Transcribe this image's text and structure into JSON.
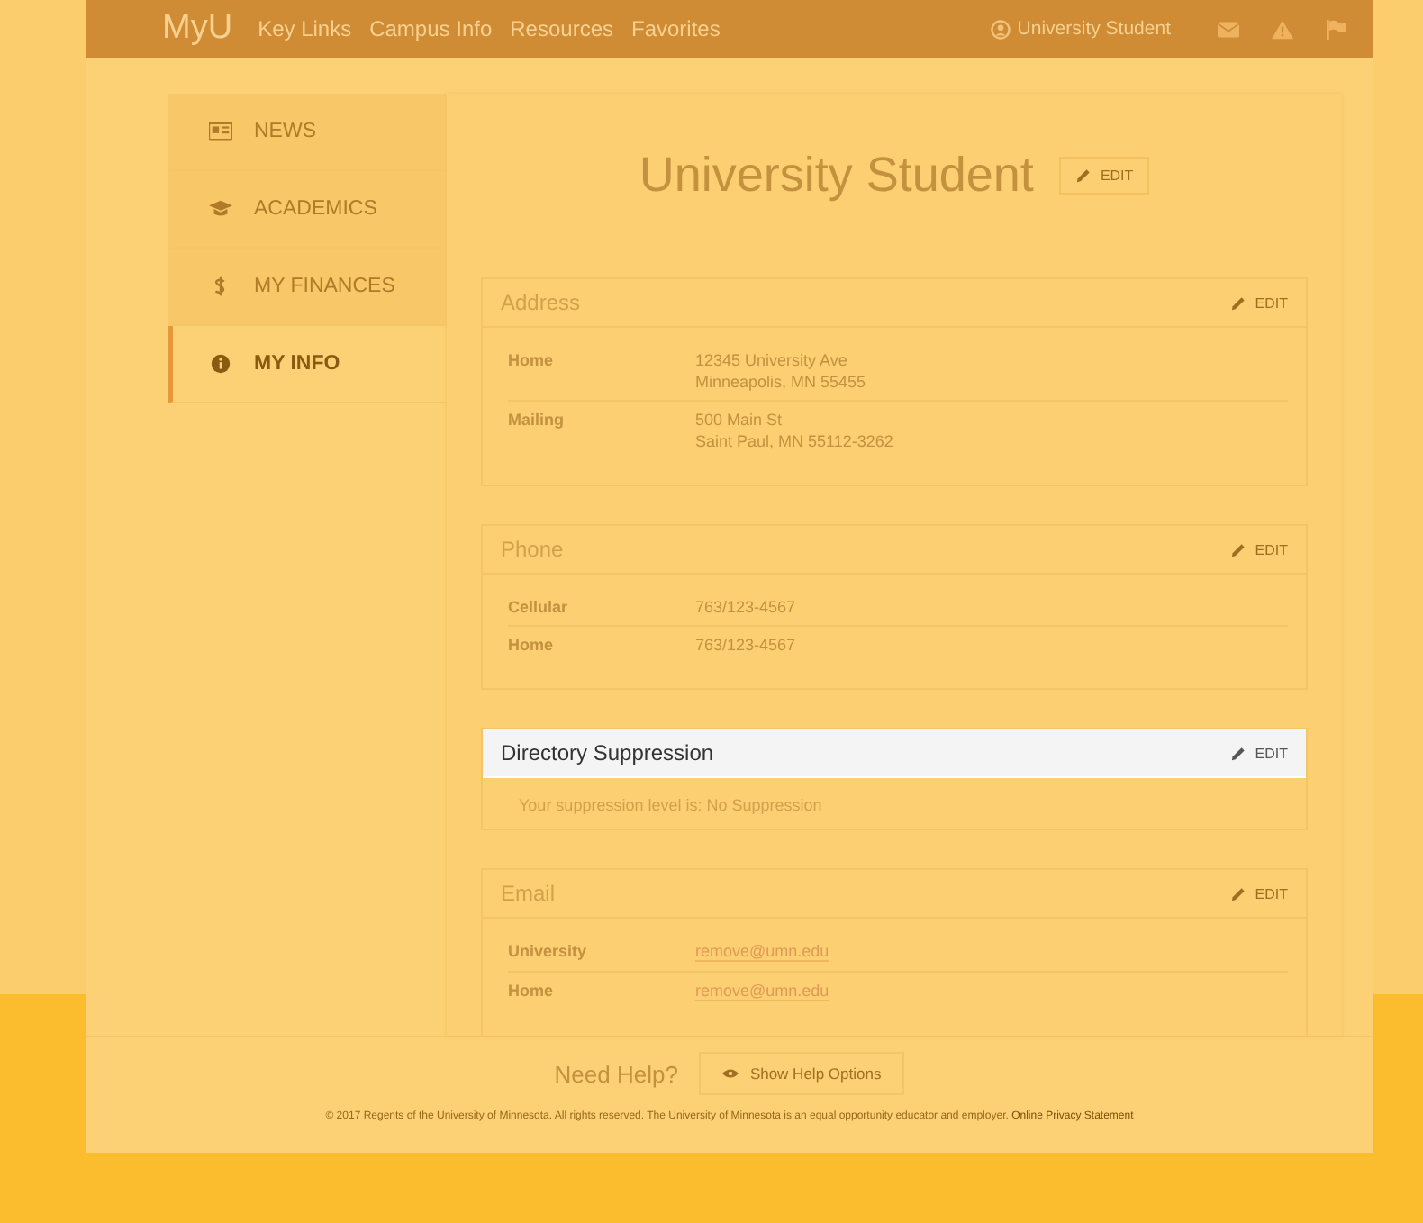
{
  "nav": {
    "logo": "MyU",
    "links": [
      "Key Links",
      "Campus Info",
      "Resources",
      "Favorites"
    ],
    "user": "University Student"
  },
  "sidebar": {
    "items": [
      {
        "label": "NEWS",
        "selected": false
      },
      {
        "label": "ACADEMICS",
        "selected": false
      },
      {
        "label": "MY FINANCES",
        "selected": false
      },
      {
        "label": "MY INFO",
        "selected": true
      }
    ]
  },
  "profile": {
    "name": "University Student",
    "edit": "EDIT"
  },
  "sections": [
    {
      "title": "Address",
      "edit": "EDIT",
      "highlighted": false,
      "kind": "rows",
      "rows": [
        {
          "label": "Home",
          "kind": "text",
          "lines": [
            "12345 University Ave",
            "Minneapolis, MN 55455"
          ]
        },
        {
          "label": "Mailing",
          "kind": "text",
          "lines": [
            "500 Main St",
            "Saint Paul, MN 55112-3262"
          ]
        }
      ]
    },
    {
      "title": "Phone",
      "edit": "EDIT",
      "highlighted": false,
      "kind": "rows",
      "rows": [
        {
          "label": "Cellular",
          "kind": "text",
          "lines": [
            "763/123-4567"
          ]
        },
        {
          "label": "Home",
          "kind": "text",
          "lines": [
            "763/123-4567"
          ]
        }
      ]
    },
    {
      "title": "Directory Suppression",
      "edit": "EDIT",
      "highlighted": true,
      "kind": "note",
      "text": "Your suppression level is: No Suppression"
    },
    {
      "title": "Email",
      "edit": "EDIT",
      "highlighted": false,
      "kind": "rows",
      "rows": [
        {
          "label": "University",
          "kind": "link",
          "lines": [
            "remove@umn.edu"
          ]
        },
        {
          "label": "Home",
          "kind": "link",
          "lines": [
            "remove@umn.edu"
          ]
        }
      ]
    }
  ],
  "footer": {
    "question": "Need Help?",
    "button": "Show Help Options",
    "legal": "© 2017 Regents of the University of Minnesota. All rights reserved. The University of Minnesota is an equal opportunity educator and employer.",
    "link": "Online Privacy Statement"
  }
}
